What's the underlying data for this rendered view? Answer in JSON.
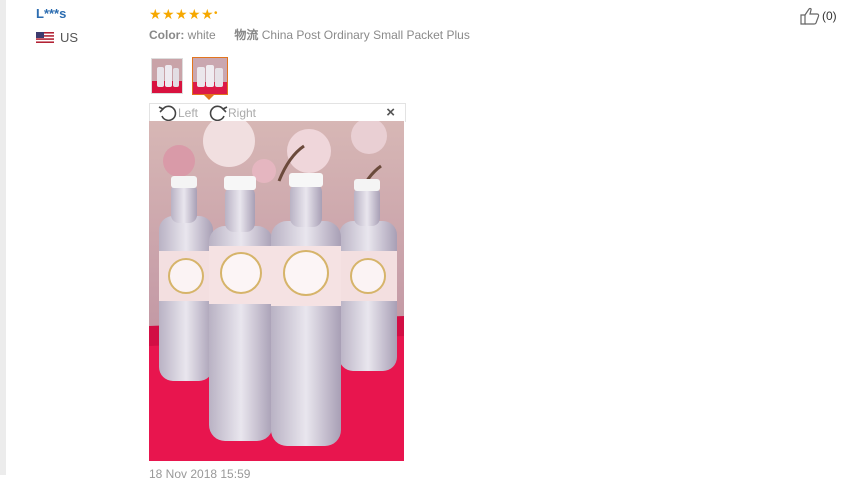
{
  "review": {
    "username": "L***s",
    "country": "US",
    "rating": 5,
    "color_label": "Color:",
    "color_value": "white",
    "shipping_label": "物流",
    "shipping_value": "China Post Ordinary Small Packet Plus",
    "helpful_count": "(0)",
    "date": "18 Nov 2018 15:59"
  },
  "viewer": {
    "rotate_left_label": "Left",
    "rotate_right_label": "Right",
    "close_label": "×"
  },
  "colors": {
    "username": "#2b6cb0",
    "star": "#f6a800",
    "selected_thumb": "#e2751e",
    "tablecloth": "#e8154e"
  },
  "icons": [
    "us-flag-icon",
    "star-icon",
    "thumbs-up-icon",
    "rotate-left-icon",
    "rotate-right-icon",
    "close-icon"
  ]
}
